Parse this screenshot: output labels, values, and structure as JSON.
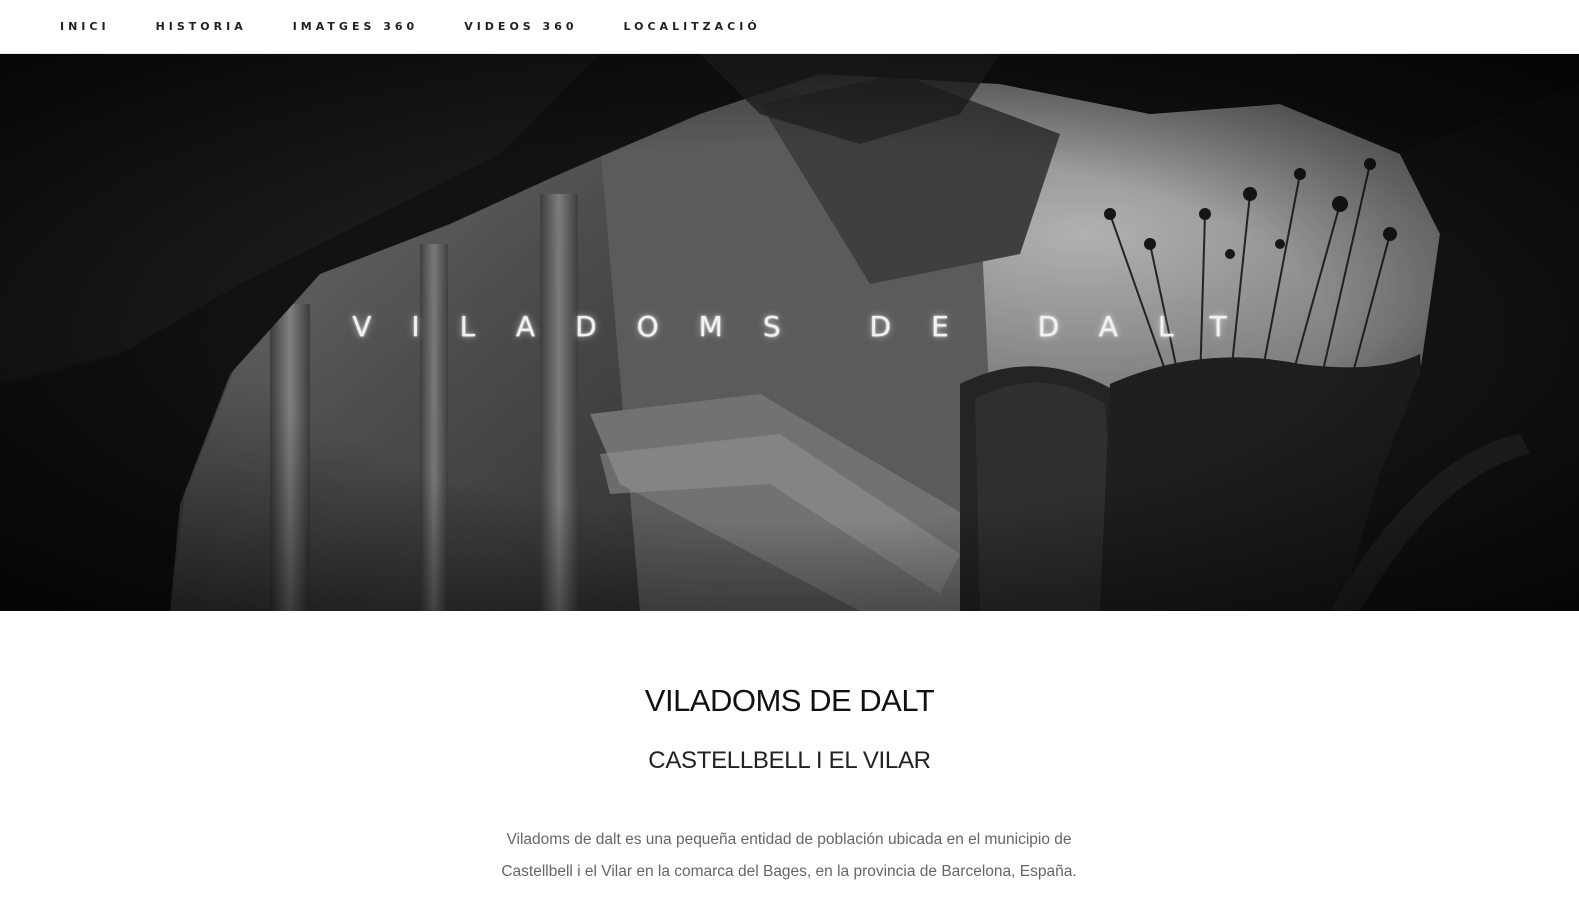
{
  "nav": {
    "items": [
      {
        "label": "INICI"
      },
      {
        "label": "HISTORIA"
      },
      {
        "label": "IMATGES 360"
      },
      {
        "label": "VIDEOS 360"
      },
      {
        "label": "LOCALITZACIÓ"
      }
    ]
  },
  "hero": {
    "title": "VILADOMS DE DALT"
  },
  "main": {
    "heading": "VILADOMS DE DALT",
    "subheading": "CASTELLBELL I EL VILAR",
    "intro": "Viladoms de dalt es una pequeña entidad de población ubicada en el municipio de Castellbell i el Vilar en la comarca del Bages, en la provincia de Barcelona, España."
  },
  "colors": {
    "nav_text": "#222222",
    "hero_text": "#f2f2f2",
    "heading": "#111111",
    "body_text": "#666666"
  }
}
